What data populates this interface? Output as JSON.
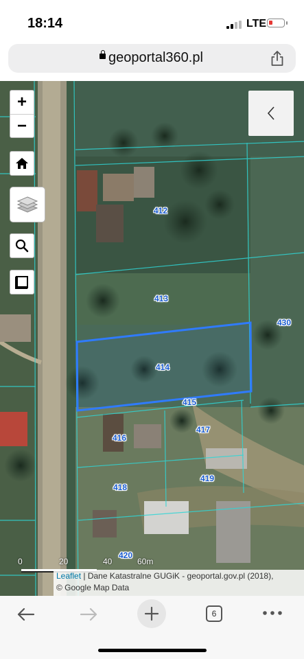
{
  "status": {
    "time": "18:14",
    "network": "LTE"
  },
  "browser": {
    "url": "geoportal360.pl",
    "tabs_count": "6"
  },
  "map": {
    "controls": {
      "zoom_in": "+",
      "zoom_out": "−"
    },
    "parcels": [
      {
        "id": "412"
      },
      {
        "id": "413"
      },
      {
        "id": "414",
        "selected": true
      },
      {
        "id": "415"
      },
      {
        "id": "416"
      },
      {
        "id": "417"
      },
      {
        "id": "418"
      },
      {
        "id": "419"
      },
      {
        "id": "420"
      },
      {
        "id": "430"
      }
    ],
    "scale": {
      "labels": [
        "0",
        "20",
        "40",
        "60m"
      ]
    },
    "attribution": {
      "leaflet": "Leaflet",
      "text": " | Dane Katastralne GUGiK - geoportal.gov.pl (2018),",
      "line2": "© Google Map Data"
    },
    "colors": {
      "parcel_line": "#2fd6d6",
      "selected_parcel": "#2f7bff",
      "label": "#1a5ccf"
    }
  }
}
